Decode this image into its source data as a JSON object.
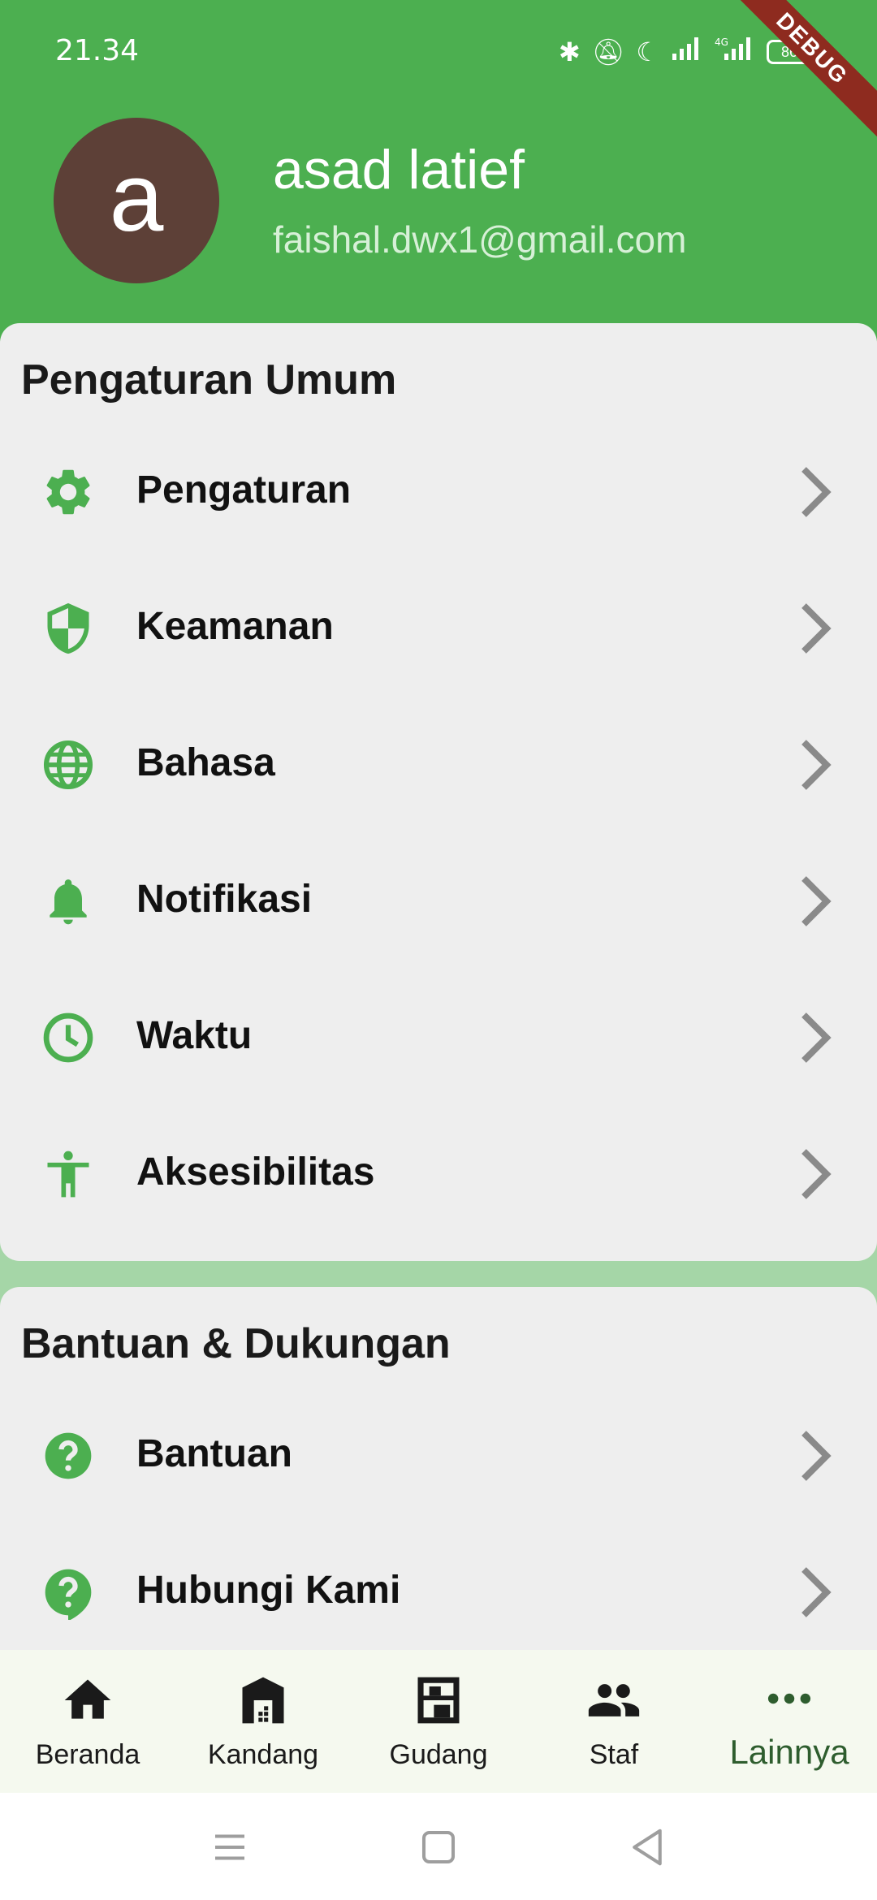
{
  "status": {
    "time": "21.34",
    "battery": "86",
    "debug_label": "DEBUG"
  },
  "profile": {
    "avatar_letter": "a",
    "name": "asad latief",
    "email": "faishal.dwx1@gmail.com"
  },
  "general_settings": {
    "title": "Pengaturan Umum",
    "items": [
      {
        "label": "Pengaturan",
        "icon": "gear-icon"
      },
      {
        "label": "Keamanan",
        "icon": "shield-icon"
      },
      {
        "label": "Bahasa",
        "icon": "globe-icon"
      },
      {
        "label": "Notifikasi",
        "icon": "bell-icon"
      },
      {
        "label": "Waktu",
        "icon": "clock-icon"
      },
      {
        "label": "Aksesibilitas",
        "icon": "accessibility-icon"
      }
    ]
  },
  "help_support": {
    "title": "Bantuan & Dukungan",
    "items": [
      {
        "label": "Bantuan",
        "icon": "help-icon"
      },
      {
        "label": "Hubungi Kami",
        "icon": "contact-help-icon"
      }
    ]
  },
  "bottom_nav": {
    "items": [
      {
        "label": "Beranda",
        "icon": "home-icon"
      },
      {
        "label": "Kandang",
        "icon": "barn-icon"
      },
      {
        "label": "Gudang",
        "icon": "shelf-icon"
      },
      {
        "label": "Staf",
        "icon": "people-icon"
      },
      {
        "label": "Lainnya",
        "icon": "more-icon",
        "active": true
      }
    ]
  },
  "colors": {
    "primary": "#4caf50",
    "card": "#eeeeee",
    "avatar": "#5d4037",
    "active_nav": "#2e5d2e"
  }
}
